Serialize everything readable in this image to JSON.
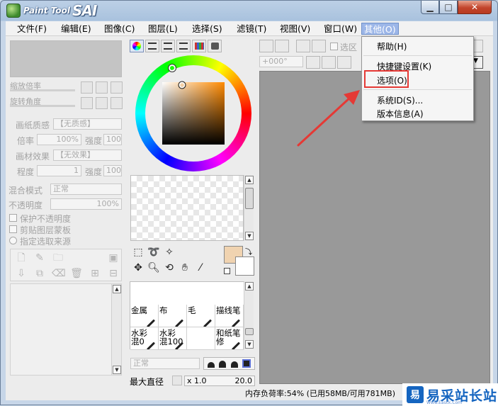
{
  "window": {
    "logo_small": "Paint Tool",
    "logo_big": "SAI",
    "min_glyph": "▁",
    "max_glyph": "□",
    "close_glyph": "✕"
  },
  "menubar": [
    {
      "label": "文件(F)"
    },
    {
      "label": "编辑(E)"
    },
    {
      "label": "图像(C)"
    },
    {
      "label": "图层(L)"
    },
    {
      "label": "选择(S)"
    },
    {
      "label": "滤镜(T)"
    },
    {
      "label": "视图(V)"
    },
    {
      "label": "窗口(W)"
    },
    {
      "label": "其他(O)",
      "active": true
    }
  ],
  "dropdown": {
    "items": [
      {
        "label": "帮助(H)"
      },
      {
        "label": "快捷键设置(K)"
      },
      {
        "label": "选项(O)",
        "highlighted": true
      },
      {
        "label": "系统ID(S)..."
      },
      {
        "label": "版本信息(A)"
      }
    ]
  },
  "left_panel": {
    "zoom_label": "缩放倍率",
    "rotate_label": "旋转角度",
    "paper_texture_label": "画纸质感",
    "paper_texture_value": "【无质感】",
    "scale_label": "倍率",
    "scale_value": "100%",
    "strength_label": "强度",
    "strength_value": "100",
    "material_effect_label": "画材效果",
    "material_effect_value": "【无效果】",
    "degree_label": "程度",
    "degree_value": "1",
    "strength2_label": "强度",
    "strength2_value": "100",
    "blend_mode_label": "混合模式",
    "blend_mode_value": "正常",
    "opacity_label": "不透明度",
    "opacity_value": "100%",
    "preserve_opacity": "保护不透明度",
    "clipping_group": "剪贴图层蒙板",
    "selection_source": "指定选取来源"
  },
  "brush_grid": [
    {
      "label": "金属"
    },
    {
      "label": "布"
    },
    {
      "label": "毛"
    },
    {
      "label": "描线笔"
    },
    {
      "label": "水彩\n混0"
    },
    {
      "label": "水彩\n混100"
    },
    {
      "label": ""
    },
    {
      "label": "和纸笔\n修"
    }
  ],
  "brush_panel": {
    "mode_value": "正常",
    "max_diameter_label": "最大直径",
    "size_multiplier": "x 1.0",
    "size_value": "20.0"
  },
  "canvas_toolbar": {
    "rotation_value": "+000°",
    "selection_label": "选区"
  },
  "status": {
    "memory_text": "内存负荷率:54% (已用58MB/可用781MB)"
  },
  "watermark": {
    "glyph": "易",
    "text": "易采站长站",
    "sub": "Www.Easck.Com"
  },
  "colors": {
    "accent_menu": "#9cb6e8",
    "highlight_red": "#e53935",
    "primary_color": "#f0d3b0",
    "secondary_color": "#ffffff"
  }
}
